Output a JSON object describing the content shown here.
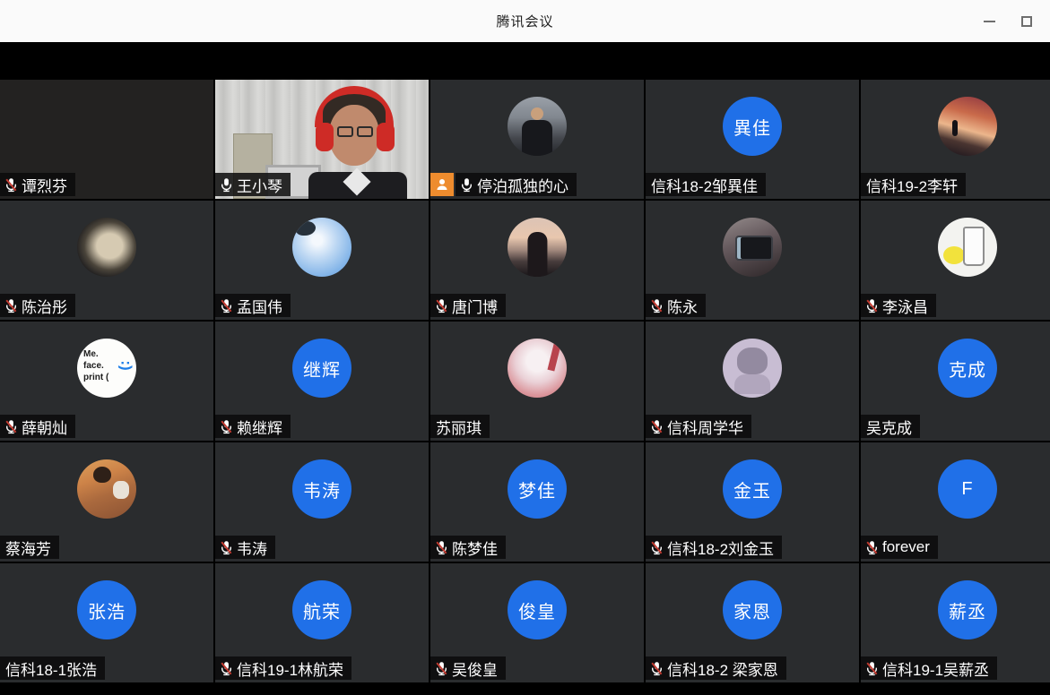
{
  "window": {
    "title": "腾讯会议"
  },
  "colors": {
    "avatar_blue": "#2070e8",
    "active_speaker_border": "#2bac64",
    "host_badge_orange": "#ee8c2e",
    "muted_slash_red": "#c13a30",
    "tile_background": "#2a2c2e"
  },
  "participants": [
    {
      "name": "谭烈芬",
      "mic": "muted",
      "avatar": {
        "type": "video-dark"
      }
    },
    {
      "name": "王小琴",
      "mic": "on",
      "active_speaker": true,
      "avatar": {
        "type": "video-person"
      }
    },
    {
      "name": "停泊孤独的心",
      "mic": "on",
      "host_badge": true,
      "avatar": {
        "type": "photo",
        "style": "suit"
      }
    },
    {
      "name": "信科18-2邹異佳",
      "mic": "none",
      "avatar": {
        "type": "initials",
        "text": "異佳"
      }
    },
    {
      "name": "信科19-2李轩",
      "mic": "none",
      "avatar": {
        "type": "photo",
        "style": "sunset-sky"
      }
    },
    {
      "name": "陈治彤",
      "mic": "muted",
      "avatar": {
        "type": "photo",
        "style": "anime-face"
      }
    },
    {
      "name": "孟国伟",
      "mic": "muted",
      "avatar": {
        "type": "photo",
        "style": "sky"
      }
    },
    {
      "name": "唐门博",
      "mic": "muted",
      "avatar": {
        "type": "photo",
        "style": "dusk-silhouette"
      }
    },
    {
      "name": "陈永",
      "mic": "muted",
      "avatar": {
        "type": "photo",
        "style": "phone"
      }
    },
    {
      "name": "李泳昌",
      "mic": "muted",
      "avatar": {
        "type": "photo",
        "style": "drink"
      }
    },
    {
      "name": "薛朝灿",
      "mic": "muted",
      "avatar": {
        "type": "text-card",
        "lines": [
          "Me.",
          "face.",
          "print ("
        ],
        "smiley": ":)"
      }
    },
    {
      "name": "赖继辉",
      "mic": "muted",
      "avatar": {
        "type": "initials",
        "text": "继辉"
      }
    },
    {
      "name": "苏丽琪",
      "mic": "none",
      "avatar": {
        "type": "photo",
        "style": "anime-girl"
      }
    },
    {
      "name": "信科周学华",
      "mic": "muted",
      "avatar": {
        "type": "photo",
        "style": "anime-boy"
      }
    },
    {
      "name": "吴克成",
      "mic": "none",
      "avatar": {
        "type": "initials",
        "text": "克成"
      }
    },
    {
      "name": "蔡海芳",
      "mic": "none",
      "avatar": {
        "type": "photo",
        "style": "warm-scene"
      }
    },
    {
      "name": "韦涛",
      "mic": "muted",
      "avatar": {
        "type": "initials",
        "text": "韦涛"
      }
    },
    {
      "name": "陈梦佳",
      "mic": "muted",
      "avatar": {
        "type": "initials",
        "text": "梦佳"
      }
    },
    {
      "name": "信科18-2刘金玉",
      "mic": "muted",
      "avatar": {
        "type": "initials",
        "text": "金玉"
      }
    },
    {
      "name": "forever",
      "mic": "muted",
      "avatar": {
        "type": "initials",
        "text": "F"
      }
    },
    {
      "name": "信科18-1张浩",
      "mic": "none",
      "avatar": {
        "type": "initials",
        "text": "张浩"
      }
    },
    {
      "name": "信科19-1林航荣",
      "mic": "muted",
      "avatar": {
        "type": "initials",
        "text": "航荣"
      }
    },
    {
      "name": "吴俊皇",
      "mic": "muted",
      "avatar": {
        "type": "initials",
        "text": "俊皇"
      }
    },
    {
      "name": "信科18-2 梁家恩",
      "mic": "muted",
      "avatar": {
        "type": "initials",
        "text": "家恩"
      }
    },
    {
      "name": "信科19-1吴薪丞",
      "mic": "muted",
      "avatar": {
        "type": "initials",
        "text": "薪丞"
      }
    }
  ]
}
